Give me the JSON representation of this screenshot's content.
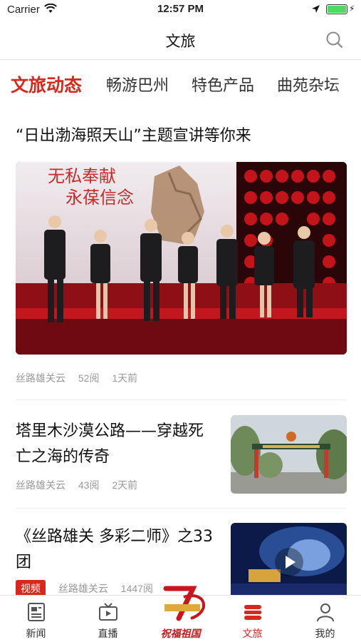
{
  "status_bar": {
    "carrier": "Carrier",
    "time": "12:57 PM"
  },
  "nav": {
    "title": "文旅"
  },
  "tabs": [
    "文旅动态",
    "畅游巴州",
    "特色产品",
    "曲苑杂坛"
  ],
  "featured": {
    "title": "“日出渤海照天山”主题宣讲等你来",
    "image_banner": [
      "无私奉献",
      "永葆信念"
    ],
    "source": "丝路雄关云",
    "reads": "52阅",
    "time": "1天前"
  },
  "articles": [
    {
      "title": "塔里木沙漠公路——穿越死亡之海的传奇",
      "source": "丝路雄关云",
      "reads": "43阅",
      "time": "2天前",
      "badge": ""
    },
    {
      "title": "《丝路雄关 多彩二师》之33团",
      "source": "丝路雄关云",
      "reads": "1447阅",
      "time": "",
      "badge": "视频"
    }
  ],
  "tab_bar": [
    {
      "label": "新闻",
      "icon": "newspaper-icon"
    },
    {
      "label": "直播",
      "icon": "tv-icon"
    },
    {
      "label": "祝福祖国",
      "icon": "anniversary-logo"
    },
    {
      "label": "文旅",
      "icon": "culture-tourism-icon"
    },
    {
      "label": "我的",
      "icon": "person-icon"
    }
  ],
  "colors": {
    "accent": "#d8281d",
    "meta_gray": "#999999",
    "divider": "#ececec"
  }
}
